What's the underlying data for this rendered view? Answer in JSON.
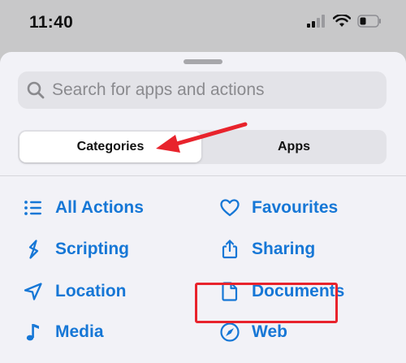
{
  "status_bar": {
    "time": "11:40"
  },
  "search": {
    "placeholder": "Search for apps and actions"
  },
  "segments": {
    "categories": "Categories",
    "apps": "Apps",
    "selected": "Categories"
  },
  "categories": {
    "all_actions": "All Actions",
    "favourites": "Favourites",
    "scripting": "Scripting",
    "sharing": "Sharing",
    "location": "Location",
    "documents": "Documents",
    "media": "Media",
    "web": "Web"
  },
  "colors": {
    "accent": "#1677d6",
    "annotation": "#e8232c",
    "sheet": "#f2f2f7"
  },
  "icons": [
    "list-icon",
    "heart-icon",
    "scripting-icon",
    "share-icon",
    "location-arrow-icon",
    "document-icon",
    "music-note-icon",
    "compass-icon"
  ]
}
